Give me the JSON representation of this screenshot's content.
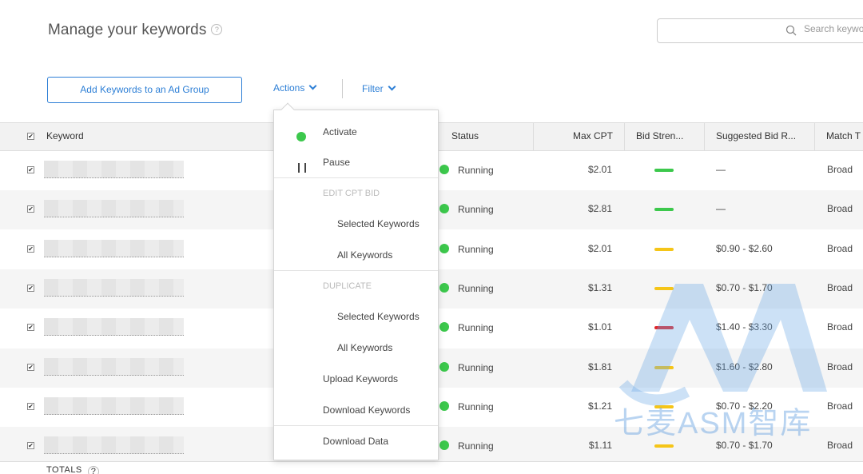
{
  "header": {
    "title": "Manage your keywords",
    "help": "?"
  },
  "search": {
    "placeholder": "Search keywords"
  },
  "toolbar": {
    "add_label": "Add Keywords to an Ad Group",
    "actions_label": "Actions",
    "filter_label": "Filter"
  },
  "table": {
    "columns": {
      "keyword": "Keyword",
      "status": "Status",
      "max_cpt": "Max CPT",
      "bid_strength": "Bid Stren...",
      "suggested_bid": "Suggested Bid R...",
      "match_type": "Match T"
    },
    "rows": [
      {
        "status": "Running",
        "max_cpt": "$2.01",
        "bid_strength": "green",
        "suggested": "—",
        "match": "Broad"
      },
      {
        "status": "Running",
        "max_cpt": "$2.81",
        "bid_strength": "green",
        "suggested": "—",
        "match": "Broad"
      },
      {
        "status": "Running",
        "max_cpt": "$2.01",
        "bid_strength": "yellow",
        "suggested": "$0.90 - $2.60",
        "match": "Broad"
      },
      {
        "status": "Running",
        "max_cpt": "$1.31",
        "bid_strength": "yellow",
        "suggested": "$0.70 - $1.70",
        "match": "Broad"
      },
      {
        "status": "Running",
        "max_cpt": "$1.01",
        "bid_strength": "red",
        "suggested": "$1.40 - $3.30",
        "match": "Broad"
      },
      {
        "status": "Running",
        "max_cpt": "$1.81",
        "bid_strength": "yellow",
        "suggested": "$1.60 - $2.80",
        "match": "Broad"
      },
      {
        "status": "Running",
        "max_cpt": "$1.21",
        "bid_strength": "yellow",
        "suggested": "$0.70 - $2.20",
        "match": "Broad"
      },
      {
        "status": "Running",
        "max_cpt": "$1.11",
        "bid_strength": "yellow",
        "suggested": "$0.70 - $1.70",
        "match": "Broad"
      }
    ],
    "totals_label": "TOTALS"
  },
  "actions_menu": {
    "activate": "Activate",
    "pause": "Pause",
    "edit_cpt_header": "EDIT CPT BID",
    "edit_selected": "Selected Keywords",
    "edit_all": "All Keywords",
    "duplicate_header": "DUPLICATE",
    "dup_selected": "Selected Keywords",
    "dup_all": "All Keywords",
    "upload": "Upload Keywords",
    "download_keywords": "Download Keywords",
    "download_data": "Download Data"
  },
  "watermark": {
    "text": "七麦ASM智库",
    "logo": "AM"
  },
  "colors": {
    "accent": "#2d7fd6",
    "running": "#3cc84c",
    "strength_green": "#3cc84c",
    "strength_yellow": "#f5c518",
    "strength_red": "#e0262a"
  }
}
